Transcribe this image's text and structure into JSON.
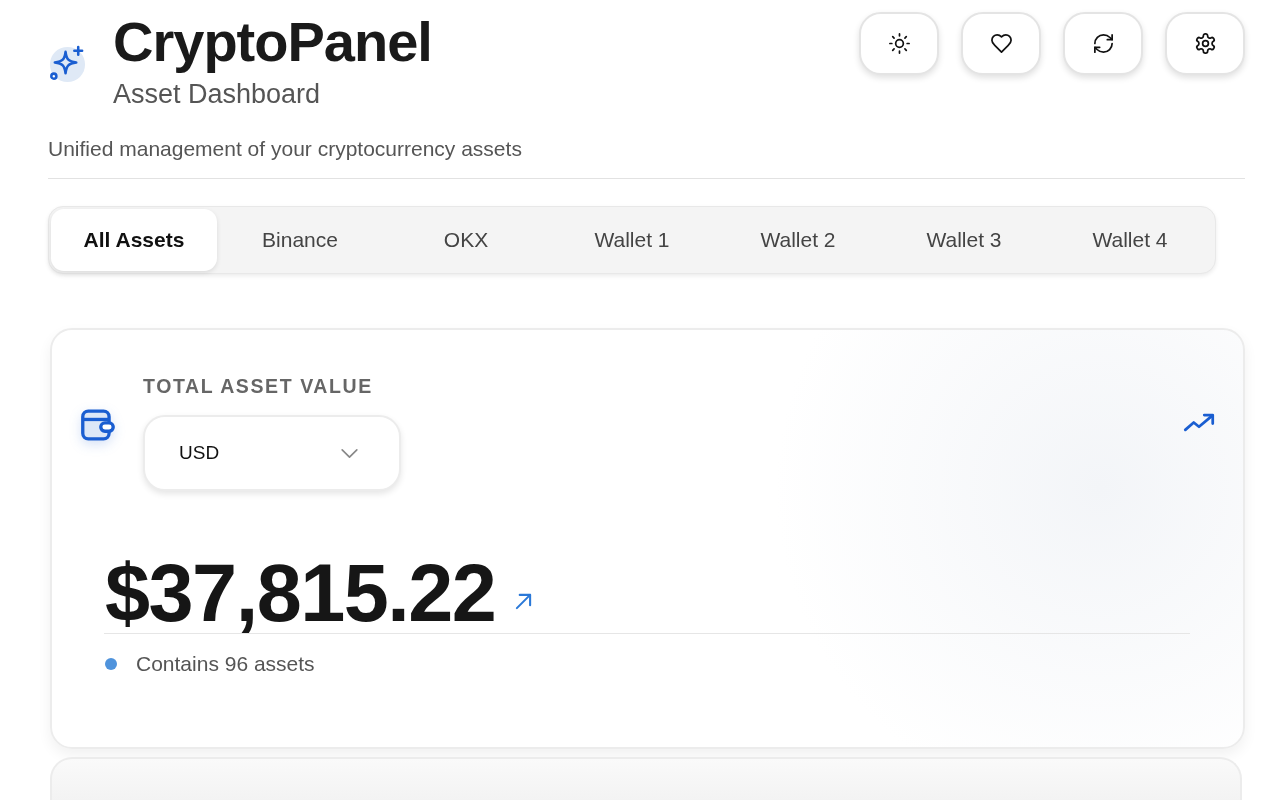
{
  "header": {
    "title": "CryptoPanel",
    "subtitle": "Asset Dashboard",
    "description": "Unified management of your cryptocurrency assets"
  },
  "tabs": [
    {
      "label": "All Assets",
      "selected": true
    },
    {
      "label": "Binance",
      "selected": false
    },
    {
      "label": "OKX",
      "selected": false
    },
    {
      "label": "Wallet 1",
      "selected": false
    },
    {
      "label": "Wallet 2",
      "selected": false
    },
    {
      "label": "Wallet 3",
      "selected": false
    },
    {
      "label": "Wallet 4",
      "selected": false
    }
  ],
  "total_card": {
    "heading": "TOTAL ASSET VALUE",
    "currency": {
      "value": "USD"
    },
    "amount": "$37,815.22",
    "note": "Contains 96 assets"
  }
}
